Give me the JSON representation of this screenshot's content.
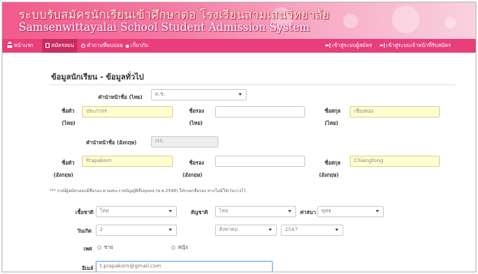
{
  "header": {
    "title_th": "ระบบรับสมัครนักเรียนเข้าศึกษาต่อ โรงเรียนสามเสนวิทยาลัย",
    "title_en": "Samsenwittayalai School Student Admission System"
  },
  "nav": {
    "left": [
      {
        "label": "หน้าแรก",
        "icon": "home-icon"
      },
      {
        "label": "สมัครสอบ",
        "icon": "document-icon"
      },
      {
        "label": "คำถามที่พบบ่อย",
        "icon": "gear-icon"
      },
      {
        "label": "เกี่ยวกับ",
        "icon": "info-icon"
      }
    ],
    "right": [
      {
        "label": "เข้าสู่ระบบผู้สมัคร",
        "icon": "login-icon"
      },
      {
        "label": "เข้าสู่ระบบเจ้าหน้าที่รับสมัคร",
        "icon": "login-icon"
      }
    ]
  },
  "section": {
    "title": "ข้อมูลนักเรียน - ข้อมูลทั่วไป"
  },
  "form": {
    "prefix_th": {
      "label": "คำนำหน้าชื่อ (ไทย)",
      "value": "ด.ช."
    },
    "firstname_th": {
      "label": "ชื่อตัว",
      "sublabel": "(ไทย)",
      "value": "ประภากร"
    },
    "middlename_th": {
      "label": "ชื่อรอง",
      "sublabel": "(ไทย)",
      "value": ""
    },
    "lastname_th": {
      "label": "ชื่อสกุล",
      "sublabel": "(ไทย)",
      "value": "เชียงทอง"
    },
    "prefix_en": {
      "label": "คำนำหน้าชื่อ (อังกฤษ)",
      "value": "MR."
    },
    "firstname_en": {
      "label": "ชื่อตัว",
      "sublabel": "(อังกฤษ)",
      "value": "Prapakorn"
    },
    "middlename_en": {
      "label": "ชื่อรอง",
      "sublabel": "(อังกฤษ)",
      "value": ""
    },
    "lastname_en": {
      "label": "ชื่อสกุล",
      "sublabel": "(อังกฤษ)",
      "value": "Chiengtong"
    },
    "note": "*** กรณีผู้สมัครสอบมีชื่อรอง ตามพระราชบัญญัติชื่อบุคคล (พ.ศ.2548) ให้กรอกชื่อรอง หากไม่มีให้เว้นว่างไว้",
    "race": {
      "label": "เชื้อชาติ",
      "value": "ไทย"
    },
    "nationality": {
      "label": "สัญชาติ",
      "value": "ไทย"
    },
    "religion": {
      "label": "ศาสนา",
      "value": "พุทธ"
    },
    "birthdate": {
      "label": "วันเกิด",
      "day": "2",
      "month": "สิงหาคม",
      "year": "2547"
    },
    "gender": {
      "label": "เพศ",
      "options": [
        "ชาย",
        "หญิง"
      ]
    },
    "email": {
      "label": "อีเมล์",
      "value": "t.prapakorn@gmail.com"
    }
  },
  "colors": {
    "nav_bg": "#e83e7b",
    "nav_active": "#c92b63",
    "required_field": "#ffffd0",
    "disabled_field": "#eeeeee"
  }
}
